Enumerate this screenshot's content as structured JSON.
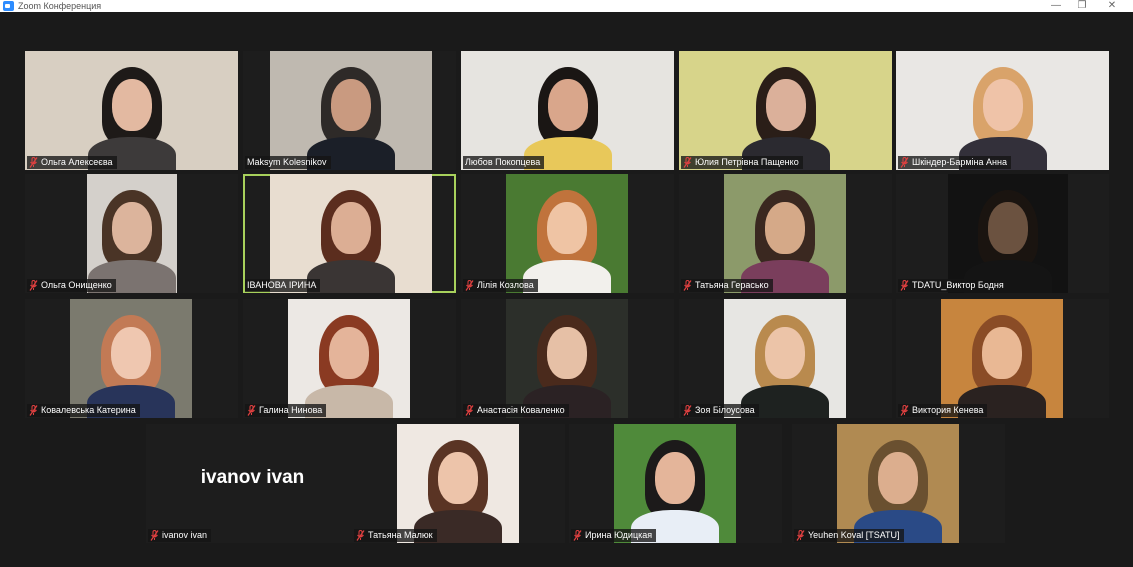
{
  "window": {
    "title": "Zoom Конференция",
    "controls": {
      "minimize": "—",
      "restore": "❐",
      "close": "✕"
    },
    "accent": "#2d8cff"
  },
  "participants": [
    {
      "name": "Ольга Алексеєва",
      "muted": true,
      "bg": "#d8cfc2",
      "skin": "#e3b9a1",
      "hair": "#1e1a18",
      "shirt": "#3d3a3a"
    },
    {
      "name": "Maksym Kolesnikov",
      "muted": false,
      "bg": "#bfb9b0",
      "skin": "#c99a80",
      "hair": "#2e2a28",
      "shirt": "#1b1f28"
    },
    {
      "name": "Любов Покопцева",
      "muted": false,
      "bg": "#e6e4e0",
      "skin": "#d9a68b",
      "hair": "#1a1614",
      "shirt": "#e8c85a"
    },
    {
      "name": "Юлия Петрівна Пащенко",
      "muted": true,
      "bg": "#d7d48a",
      "skin": "#dbb09a",
      "hair": "#2a1e18",
      "shirt": "#2b2a30"
    },
    {
      "name": "Шкіндер-Барміна Анна",
      "muted": true,
      "bg": "#e9e7e4",
      "skin": "#efc3a8",
      "hair": "#d9a36a",
      "shirt": "#33303a"
    },
    {
      "name": "Ольга Онищенко",
      "muted": true,
      "bg": "#d4d0cb",
      "skin": "#dcb49c",
      "hair": "#4a3426",
      "shirt": "#7b7370"
    },
    {
      "name": "ІВАНОВА ІРИНА",
      "muted": false,
      "active": true,
      "bg": "#e8ddd0",
      "skin": "#dcae94",
      "hair": "#5b2d1e",
      "shirt": "#3a3534"
    },
    {
      "name": "Лілія Козлова",
      "muted": true,
      "bg": "#4a7a32",
      "skin": "#efc4a4",
      "hair": "#c0733c",
      "shirt": "#f2f0ec"
    },
    {
      "name": "Татьяна Герасько",
      "muted": true,
      "bg": "#8c9a6a",
      "skin": "#d5a988",
      "hair": "#3a2820",
      "shirt": "#7a3e5c"
    },
    {
      "name": "TDATU_Виктор Бодня",
      "muted": true,
      "bg": "#121212",
      "skin": "#6b5240",
      "hair": "#1a1410",
      "shirt": "#141414"
    },
    {
      "name": "Ковалевська Катерина",
      "muted": true,
      "bg": "#7b7a6e",
      "skin": "#efc7b0",
      "hair": "#c27a55",
      "shirt": "#28345a"
    },
    {
      "name": "Галина Нинова",
      "muted": true,
      "bg": "#ece8e4",
      "skin": "#e4b49a",
      "hair": "#8a3a22",
      "shirt": "#c8b8a8"
    },
    {
      "name": "Анастасія Коваленко",
      "muted": true,
      "bg": "#2c2f2a",
      "skin": "#e6c0a6",
      "hair": "#4a2a1c",
      "shirt": "#2b2224"
    },
    {
      "name": "Зоя Білоусова",
      "muted": true,
      "bg": "#e7e6e3",
      "skin": "#ecc4a8",
      "hair": "#b98a4e",
      "shirt": "#1e2220"
    },
    {
      "name": "Виктория Кенева",
      "muted": true,
      "bg": "#c7853e",
      "skin": "#e9b894",
      "hair": "#8a4c26",
      "shirt": "#2a2220"
    },
    {
      "name": "ivanov ivan",
      "muted": true,
      "avatar_text": "ivanov ivan",
      "bg": "#1d1d1d"
    },
    {
      "name": "Татьяна Малюк",
      "muted": true,
      "bg": "#efe8e2",
      "skin": "#edc4aa",
      "hair": "#5a3424",
      "shirt": "#3a2a26"
    },
    {
      "name": "Ирина Юдицкая",
      "muted": true,
      "bg": "#4f8a3a",
      "skin": "#e4b59a",
      "hair": "#1c1a1a",
      "shirt": "#e8eef6"
    },
    {
      "name": "Yeuhen Koval [TSATU]",
      "muted": true,
      "bg": "#b08a52",
      "skin": "#dcae8e",
      "hair": "#6a5030",
      "shirt": "#2a4a86"
    }
  ]
}
